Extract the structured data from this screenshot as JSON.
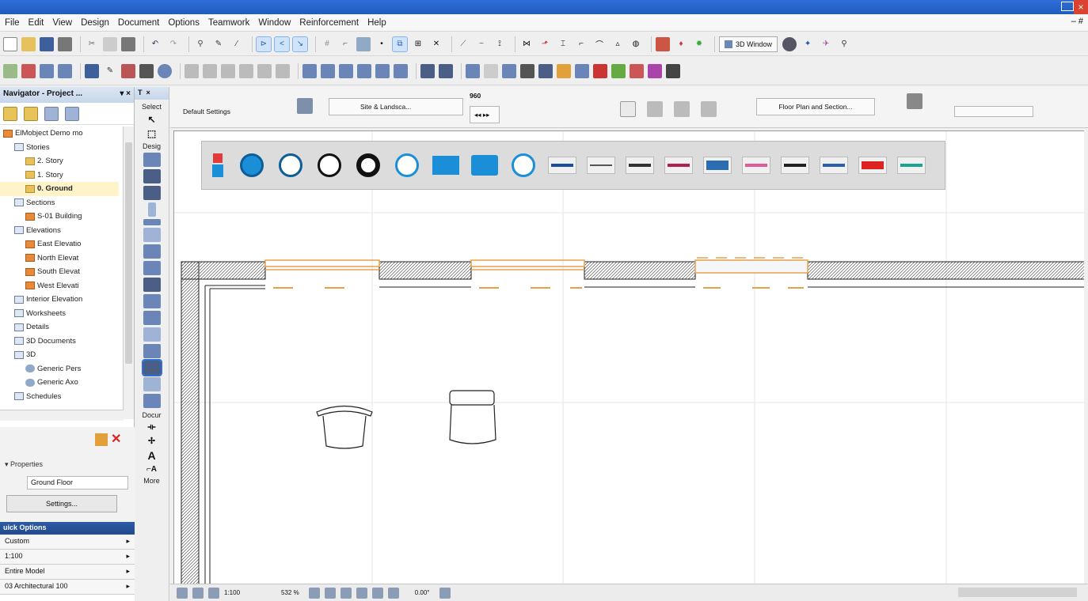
{
  "menu": [
    "File",
    "Edit",
    "View",
    "Design",
    "Document",
    "Options",
    "Teamwork",
    "Window",
    "Reinforcement",
    "Help"
  ],
  "toolbar": {
    "window3d_label": "3D Window"
  },
  "navigator": {
    "title": "Navigator - Project ...",
    "tree": [
      {
        "label": "ElMobject Demo mo",
        "icon": "house",
        "indent": 0
      },
      {
        "label": "Stories",
        "icon": "grid",
        "indent": 1
      },
      {
        "label": "2. Story",
        "icon": "folder",
        "indent": 2
      },
      {
        "label": "1. Story",
        "icon": "folder",
        "indent": 2
      },
      {
        "label": "0. Ground",
        "icon": "folder",
        "indent": 2,
        "selected": true
      },
      {
        "label": "Sections",
        "icon": "grid",
        "indent": 1
      },
      {
        "label": "S-01 Building",
        "icon": "house",
        "indent": 2
      },
      {
        "label": "Elevations",
        "icon": "grid",
        "indent": 1
      },
      {
        "label": "East Elevatio",
        "icon": "house",
        "indent": 2
      },
      {
        "label": "North Elevat",
        "icon": "house",
        "indent": 2
      },
      {
        "label": "South Elevat",
        "icon": "house",
        "indent": 2
      },
      {
        "label": "West Elevati",
        "icon": "house",
        "indent": 2
      },
      {
        "label": "Interior Elevation",
        "icon": "grid",
        "indent": 1
      },
      {
        "label": "Worksheets",
        "icon": "grid",
        "indent": 1
      },
      {
        "label": "Details",
        "icon": "grid",
        "indent": 1
      },
      {
        "label": "3D Documents",
        "icon": "grid",
        "indent": 1
      },
      {
        "label": "3D",
        "icon": "grid",
        "indent": 1
      },
      {
        "label": "Generic Pers",
        "icon": "cam",
        "indent": 2
      },
      {
        "label": "Generic Axo",
        "icon": "cam",
        "indent": 2
      },
      {
        "label": "Schedules",
        "icon": "grid",
        "indent": 1
      }
    ]
  },
  "properties": {
    "title": "Properties",
    "field_value": "Ground Floor",
    "settings_label": "Settings..."
  },
  "quick_options": {
    "title": "uick Options",
    "rows": [
      "Custom",
      "1:100",
      "Entire Model",
      "03 Architectural 100"
    ]
  },
  "toolbox": {
    "select_label": "Select",
    "design_label": "Desig",
    "document_label": "Docur",
    "text_tool": "A",
    "more_label": "More"
  },
  "infobox": {
    "title": "Default Settings",
    "site_label": "Site & Landsca...",
    "value_960": "960",
    "floorplan_label": "Floor Plan and Section..."
  },
  "statusbar": {
    "scale": "1:100",
    "zoom": "532 %",
    "angle": "0.00°"
  }
}
